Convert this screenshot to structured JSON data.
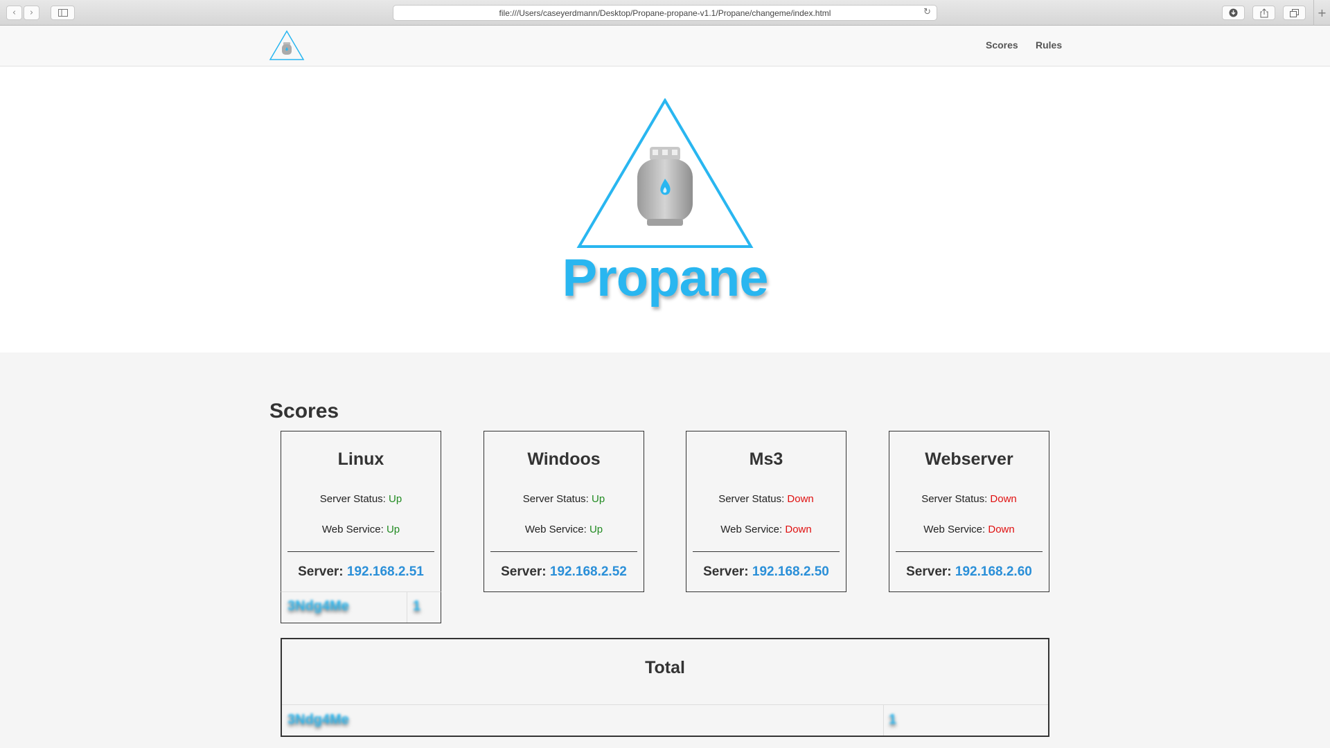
{
  "browser": {
    "url": "file:///Users/caseyerdmann/Desktop/Propane-propane-v1.1/Propane/changeme/index.html"
  },
  "nav": {
    "links": [
      "Scores",
      "Rules"
    ]
  },
  "hero": {
    "brand": "Propane",
    "accent_color": "#29b6f0"
  },
  "scores": {
    "title": "Scores",
    "status_label": "Server Status:",
    "web_label": "Web Service:",
    "server_label": "Server:",
    "cards": [
      {
        "name": "Linux",
        "server_status": "Up",
        "web_service": "Up",
        "ip": "192.168.2.51"
      },
      {
        "name": "Windoos",
        "server_status": "Up",
        "web_service": "Up",
        "ip": "192.168.2.52"
      },
      {
        "name": "Ms3",
        "server_status": "Down",
        "web_service": "Down",
        "ip": "192.168.2.50"
      },
      {
        "name": "Webserver",
        "server_status": "Down",
        "web_service": "Down",
        "ip": "192.168.2.60"
      }
    ],
    "linux_team": {
      "name": "3Ndg4Me",
      "score": "1"
    }
  },
  "total": {
    "title": "Total",
    "team": {
      "name": "3Ndg4Me",
      "score": "1"
    }
  },
  "status_colors": {
    "up": "#228b22",
    "down": "#e01010"
  }
}
